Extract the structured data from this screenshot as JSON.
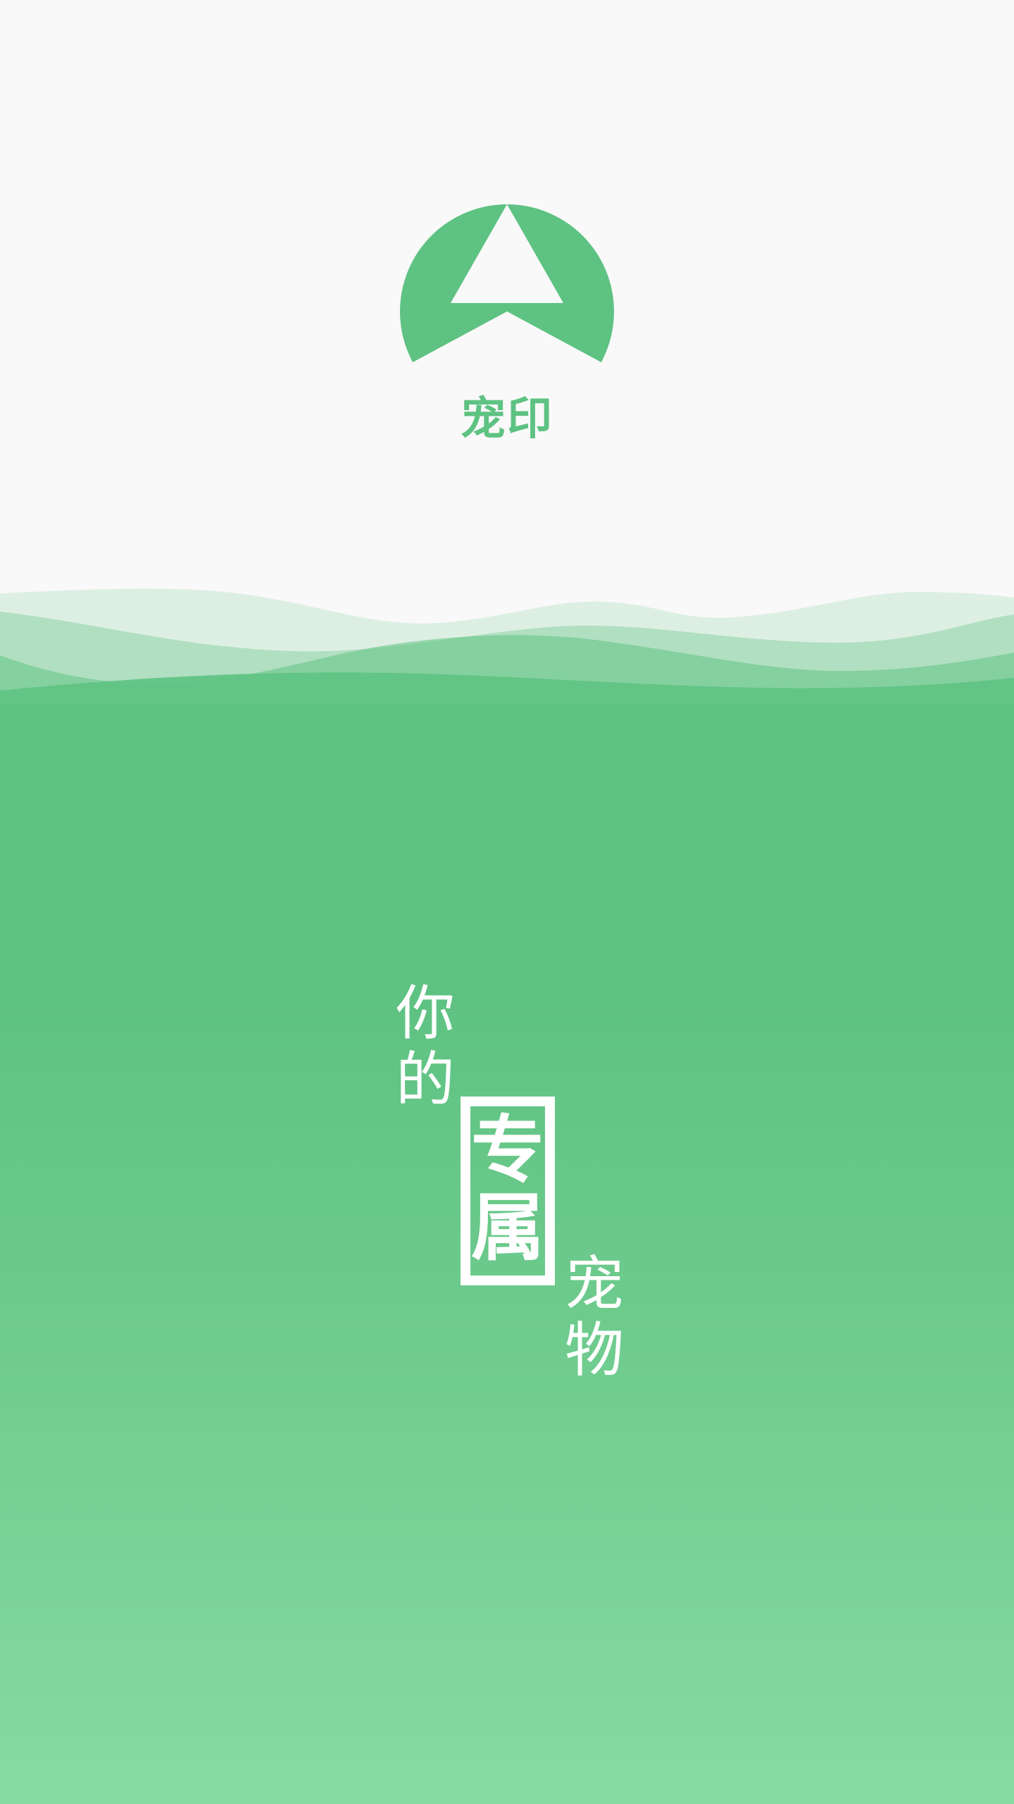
{
  "app": {
    "name": "宠印",
    "logo_icon": "triangle-circle-logo-icon"
  },
  "slogan": {
    "chars": [
      "你",
      "的",
      "专",
      "属",
      "宠",
      "物"
    ],
    "highlighted_chars": [
      "专",
      "属"
    ]
  },
  "colors": {
    "brand_green": "#5ec282",
    "light_green": "#86dba3",
    "top_background": "#f9f9f9",
    "text_on_green": "#ffffff"
  }
}
